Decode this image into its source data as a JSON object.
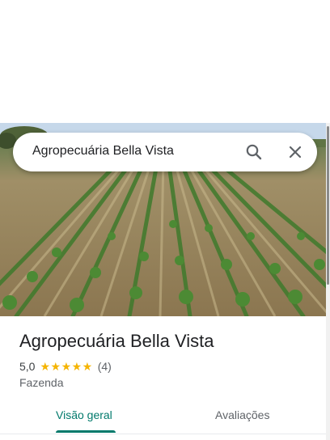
{
  "search": {
    "query": "Agropecuária Bella Vista",
    "search_icon": "search-icon",
    "close_icon": "close-icon"
  },
  "place": {
    "name": "Agropecuária Bella Vista",
    "rating": "5,0",
    "stars": "★★★★★",
    "review_count": "(4)",
    "category": "Fazenda"
  },
  "tabs": [
    {
      "label": "Visão geral",
      "active": true
    },
    {
      "label": "Avaliações",
      "active": false
    }
  ],
  "colors": {
    "accent": "#00796b",
    "star": "#f5b400"
  }
}
